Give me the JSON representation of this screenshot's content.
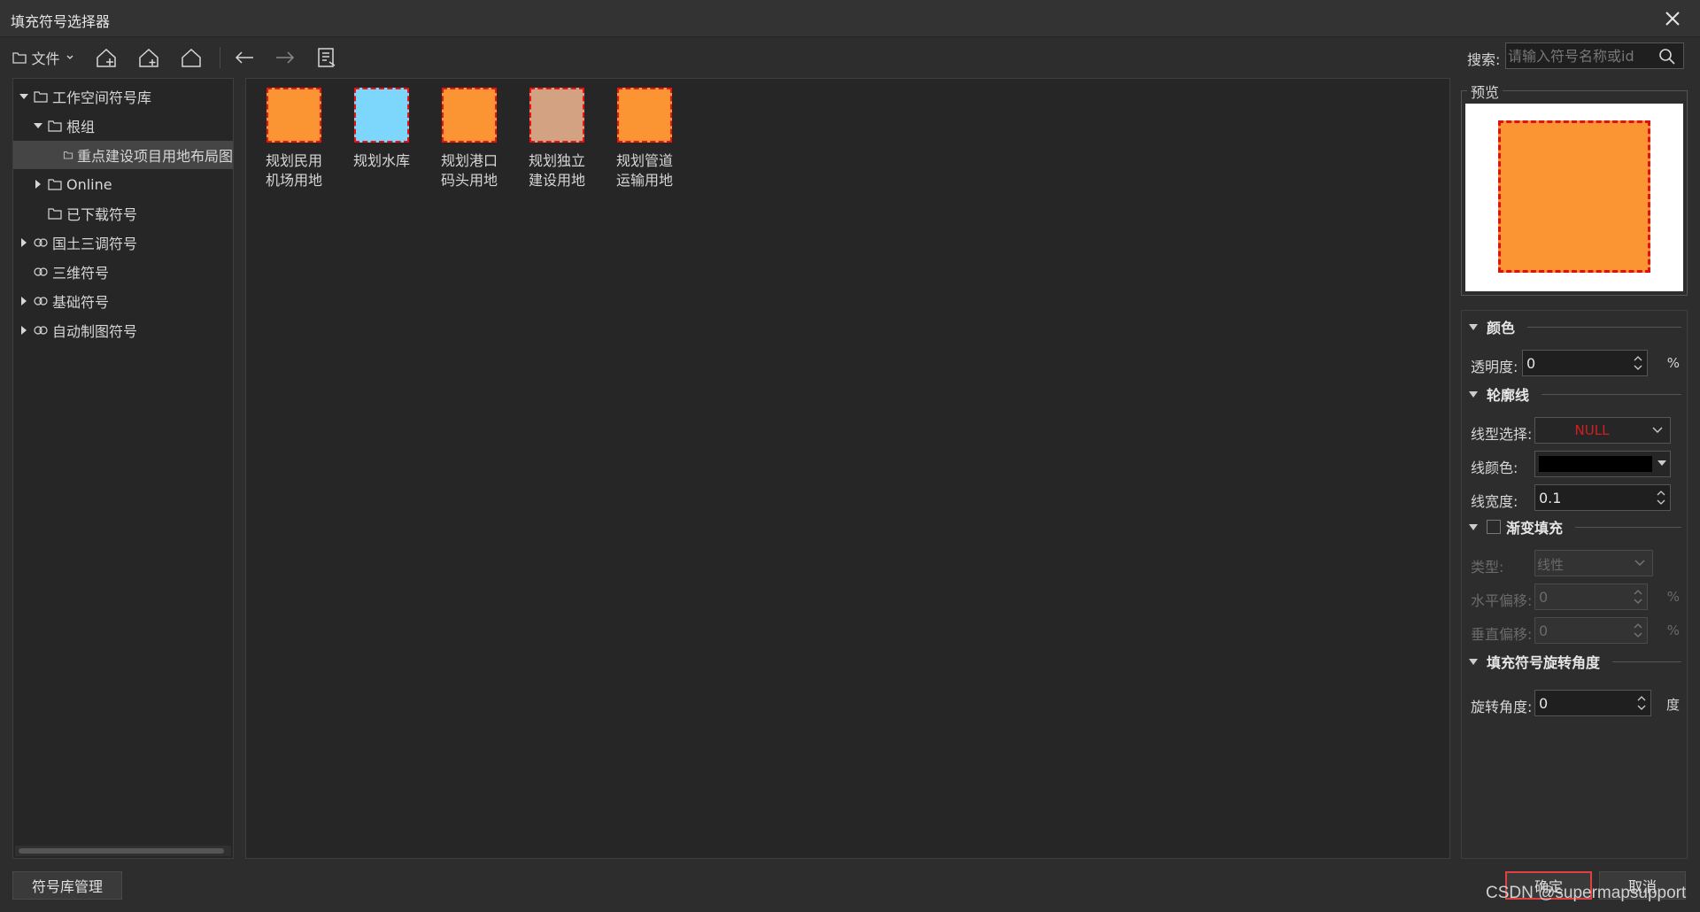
{
  "window": {
    "title": "填充符号选择器",
    "close_icon": "close-icon"
  },
  "toolbar": {
    "file_label": "文件",
    "buttons": [
      "add-group-icon",
      "add-library-icon",
      "home-icon",
      "back-arrow-icon",
      "forward-arrow-icon",
      "properties-list-icon"
    ]
  },
  "search": {
    "label": "搜索:",
    "placeholder": "请输入符号名称或id"
  },
  "tree": {
    "items": [
      {
        "label": "工作空间符号库"
      },
      {
        "label": "根组"
      },
      {
        "label": "重点建设项目用地布局图"
      },
      {
        "label": "Online"
      },
      {
        "label": "已下载符号"
      },
      {
        "label": "国土三调符号"
      },
      {
        "label": "三维符号"
      },
      {
        "label": "基础符号"
      },
      {
        "label": "自动制图符号"
      }
    ]
  },
  "symbols": [
    {
      "line1": "规划民用",
      "line2": "机场用地",
      "color": "#fb9534"
    },
    {
      "line1": "规划水库",
      "line2": "",
      "color": "#7dd6fb"
    },
    {
      "line1": "规划港口",
      "line2": "码头用地",
      "color": "#fb9534"
    },
    {
      "line1": "规划独立",
      "line2": "建设用地",
      "color": "#d3a282"
    },
    {
      "line1": "规划管道",
      "line2": "运输用地",
      "color": "#fb9534"
    }
  ],
  "preview": {
    "label": "预览",
    "fill_color": "#fb9534",
    "border_color": "#e01010"
  },
  "properties": {
    "color_section": "颜色",
    "opacity_label": "透明度:",
    "opacity_value": "0",
    "opacity_unit": "%",
    "outline_section": "轮廓线",
    "line_type_label": "线型选择:",
    "line_type_value": "NULL",
    "line_color_label": "线颜色:",
    "line_color": "#000000",
    "line_width_label": "线宽度:",
    "line_width_value": "0.1",
    "gradient_section": "渐变填充",
    "gradient_enabled": false,
    "type_label": "类型:",
    "type_value": "线性",
    "h_offset_label": "水平偏移:",
    "h_offset_value": "0",
    "h_offset_unit": "%",
    "v_offset_label": "垂直偏移:",
    "v_offset_value": "0",
    "v_offset_unit": "%",
    "rotation_section": "填充符号旋转角度",
    "rotation_label": "旋转角度:",
    "rotation_value": "0",
    "rotation_unit": "度"
  },
  "footer": {
    "manage_label": "符号库管理",
    "ok_label": "确定",
    "cancel_label": "取消",
    "watermark": "CSDN @supermapsupport"
  }
}
